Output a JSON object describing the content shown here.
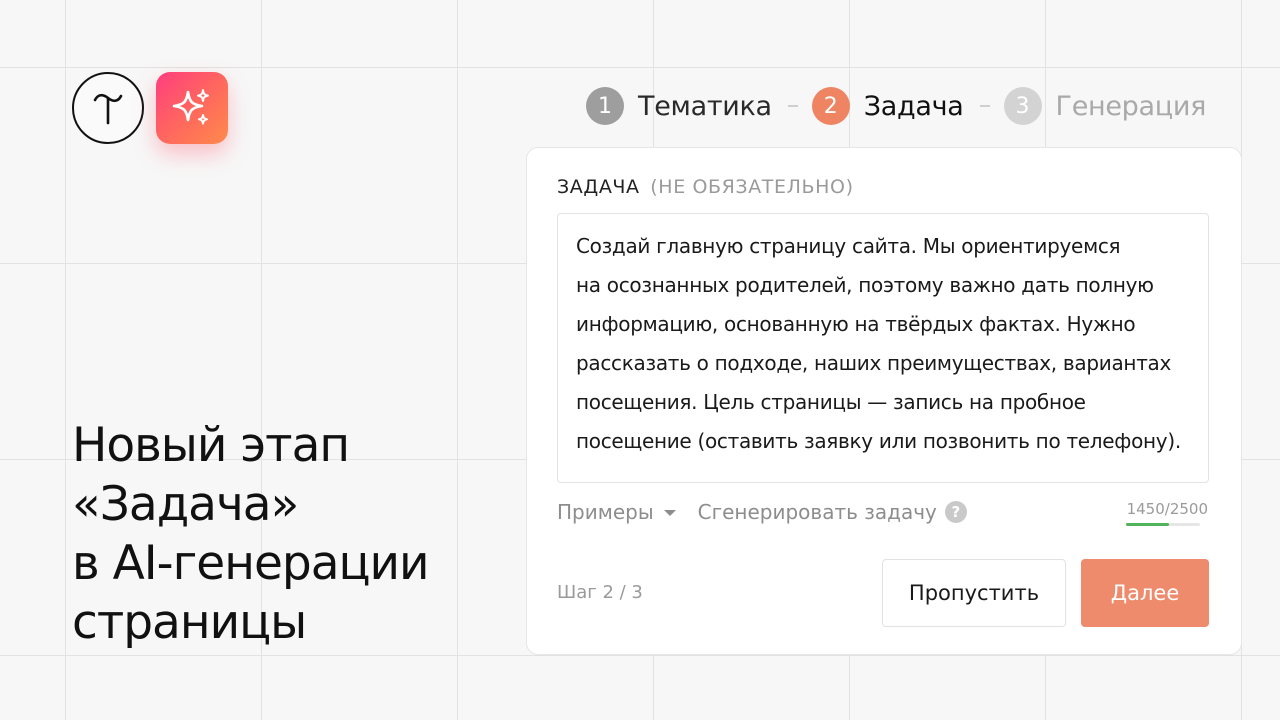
{
  "brand": {
    "logo_icon": "tilda-t-logo-icon",
    "ai_icon": "ai-sparkle-icon",
    "ai_gradient": [
      "#ff3d7f",
      "#ff8a4c"
    ]
  },
  "headline": {
    "lines": [
      "Новый этап",
      "«Задача»",
      "в AI-генерации",
      "страницы"
    ]
  },
  "stepper": {
    "steps": [
      {
        "number": "1",
        "label": "Тематика",
        "state": "done"
      },
      {
        "number": "2",
        "label": "Задача",
        "state": "active"
      },
      {
        "number": "3",
        "label": "Генерация",
        "state": "todo"
      }
    ],
    "colors": {
      "done": "#9e9e9e",
      "active": "#ee8462",
      "todo": "#d3d3d3"
    }
  },
  "task_form": {
    "label": "ЗАДАЧА",
    "label_optional": "(НЕ ОБЯЗАТЕЛЬНО)",
    "text_lines": [
      "Создай главную страницу сайта. Мы ориентируемся",
      "на осознанных родителей, поэтому важно дать полную",
      "информацию, основанную на твёрдых фактах. Нужно",
      "рассказать о подходе, наших преимуществах, вариантах",
      "посещения. Цель страницы — запись на пробное",
      "посещение (оставить заявку или позвонить по телефону)."
    ],
    "examples_label": "Примеры",
    "generate_label": "Сгенерировать задачу",
    "help_glyph": "?",
    "counter": {
      "text": "1450/2500",
      "current": 1450,
      "max": 2500,
      "color": "#52b35d"
    },
    "step_info": "Шаг  2 / 3",
    "skip_label": "Пропустить",
    "next_label": "Далее",
    "next_color": "#ee8b6d"
  }
}
